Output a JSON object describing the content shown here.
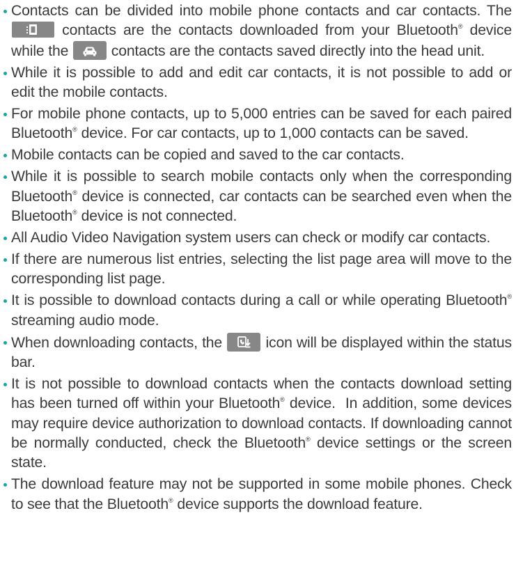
{
  "colors": {
    "bullet": "#19a6a1",
    "text": "#3a3a3a",
    "icon_bg": "#878787"
  },
  "icons": {
    "mobile_contacts": "phone-icon",
    "car_contacts": "car-icon",
    "download_status": "contacts-download-icon"
  },
  "notes": {
    "n1": {
      "a": "Contacts can be divided into mobile phone contacts and car contacts. The",
      "b": "contacts are the contacts downloaded from your Bluetooth",
      "c": "device while the",
      "d": "contacts are the contacts saved directly into the head unit."
    },
    "n2": "While it is possible to add and edit car contacts, it is not possible to add or edit the mobile contacts.",
    "n3": {
      "a": "For mobile phone contacts, up to 5,000 entries can be saved for each paired Bluetooth",
      "b": "device. For car contacts, up to 1,000 contacts can be saved."
    },
    "n4": "Mobile contacts can be copied and saved to the car contacts.",
    "n5": {
      "a": "While it is possible to search mobile contacts only when the corresponding Bluetooth",
      "b": "device is connected, car contacts can be searched even when the Bluetooth",
      "c": "device is not connected."
    },
    "n6": "All Audio Video Navigation system users can check or modify car contacts.",
    "n7": "If there are numerous list entries, selecting the list page area will move to the corresponding list page.",
    "n8": {
      "a": "It is possible to download contacts during a call or while operating Bluetooth",
      "b": "streaming audio mode."
    },
    "n9": {
      "a": "When downloading contacts, the",
      "b": "icon will be displayed within the status bar."
    },
    "n10": {
      "a": "It is not possible to download contacts when the contacts download set­ting has been turned off within your Bluetooth",
      "b": "device.  In addition, some devices may require device authorization to download contacts. If down­loading cannot be normally conducted, check the Bluetooth",
      "c": "device set­tings or the screen state."
    },
    "n11": {
      "a": "The download feature may not be supported in some mobile phones. Check to see that the Bluetooth",
      "b": "device supports the download feature."
    },
    "reg": "®"
  }
}
